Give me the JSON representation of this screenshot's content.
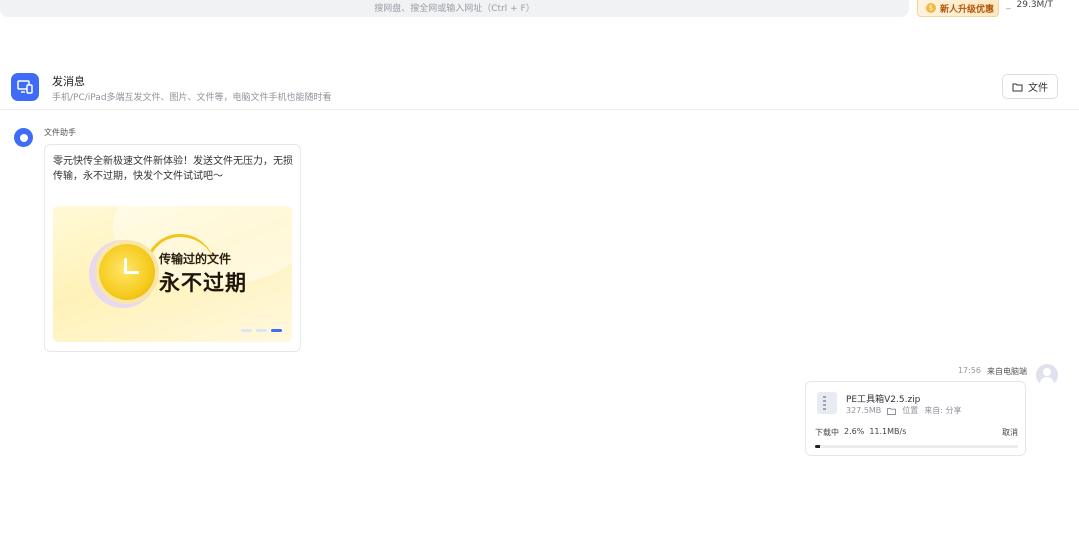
{
  "topbar": {
    "search_hint": "搜网盘、搜全网或输入网址（Ctrl + F）",
    "promo_label": "新人升级优惠",
    "promo_icon": "coin-icon",
    "speed_separator": "_",
    "speed_text": "29.3M/T"
  },
  "header": {
    "icon": "devices-icon",
    "title": "发消息",
    "subtitle": "手机/PC/iPad多端互发文件、图片、文件等，电脑文件手机也能随时看",
    "file_button_label": "文件",
    "file_button_icon": "folder-icon"
  },
  "bot_message": {
    "sender": "文件助手",
    "text": "零元快传全新极速文件新体验！发送文件无压力，无损传输，永不过期，快发个文件试试吧～",
    "banner_line1": "传输过的文件",
    "banner_line2": "永不过期",
    "carousel_active_index": 2,
    "carousel_count": 3
  },
  "user_message": {
    "time": "17:56",
    "sender": "来自电脑端",
    "file_name": "PE工具箱V2.5.zip",
    "file_size": "327.5MB",
    "location_icon": "folder-icon",
    "location_label": "位置",
    "share_label": "来自: 分享",
    "download_label": "下载中",
    "progress_text": "2.6%",
    "speed": "11.1MB/s",
    "cancel_label": "取消",
    "progress_fraction": 0.026
  },
  "colors": {
    "accent": "#3f6cf6",
    "banner_yellow": "#f6cb1d"
  }
}
